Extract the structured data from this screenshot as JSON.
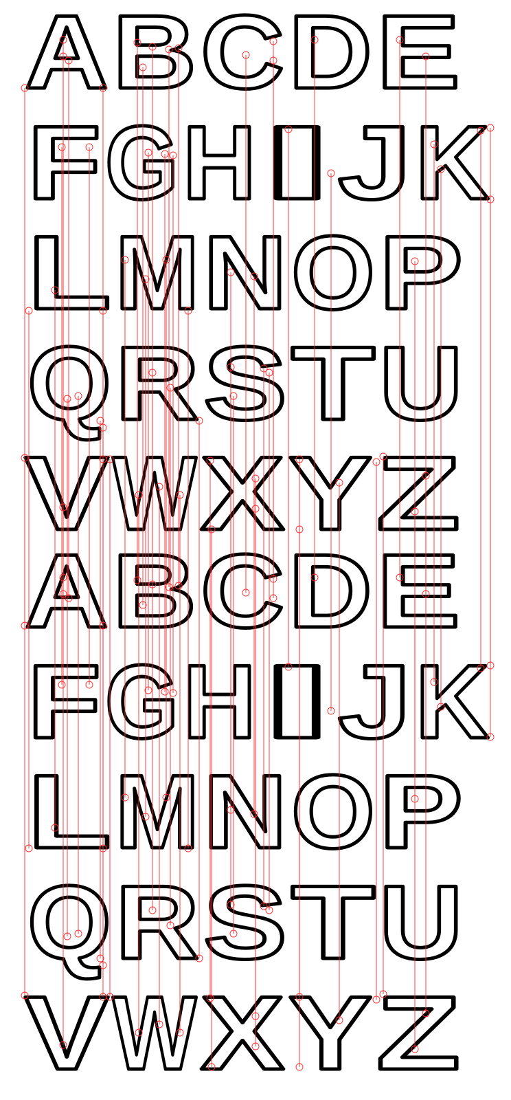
{
  "rows": [
    [
      "A",
      "B",
      "C",
      "D",
      "E"
    ],
    [
      "F",
      "G",
      "H",
      "I",
      "J",
      "K"
    ],
    [
      "L",
      "M",
      "N",
      "O",
      "P"
    ],
    [
      "Q",
      "R",
      "S",
      "T",
      "U"
    ],
    [
      "V",
      "W",
      "X",
      "Y",
      "Z"
    ],
    [
      "A",
      "B",
      "C",
      "D",
      "E"
    ],
    [
      "F",
      "G",
      "H",
      "I",
      "J",
      "K"
    ],
    [
      "L",
      "M",
      "N",
      "O",
      "P"
    ],
    [
      "Q",
      "R",
      "S",
      "T",
      "U"
    ],
    [
      "V",
      "W",
      "X",
      "Y",
      "Z"
    ]
  ],
  "colors": {
    "outline": "#000000",
    "fill": "#ffffff",
    "overlay": "#ff2a2a"
  }
}
